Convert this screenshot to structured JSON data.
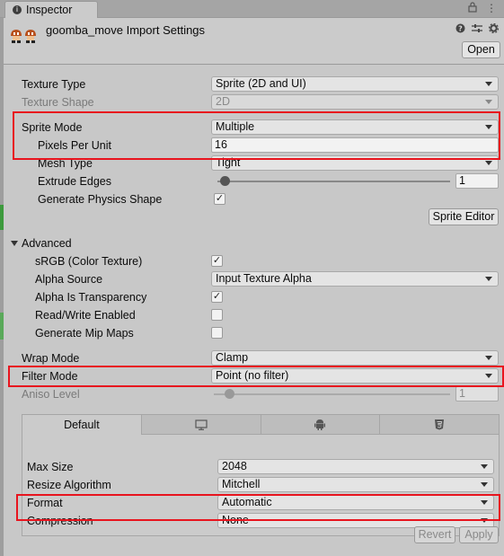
{
  "window": {
    "tab_label": "Inspector"
  },
  "header": {
    "title": "goomba_move Import Settings",
    "open_label": "Open"
  },
  "icons": {
    "info": "info-icon",
    "lock": "lock-icon",
    "more": "more-icon",
    "help": "help-icon",
    "presets": "presets-icon",
    "settings": "gear-icon"
  },
  "texture": {
    "texture_type_label": "Texture Type",
    "texture_type_value": "Sprite (2D and UI)",
    "texture_shape_label": "Texture Shape",
    "texture_shape_value": "2D",
    "sprite_mode_label": "Sprite Mode",
    "sprite_mode_value": "Multiple",
    "ppu_label": "Pixels Per Unit",
    "ppu_value": "16",
    "mesh_type_label": "Mesh Type",
    "mesh_type_value": "Tight",
    "extrude_label": "Extrude Edges",
    "extrude_value": "1",
    "physics_label": "Generate Physics Shape",
    "sprite_editor_label": "Sprite Editor"
  },
  "advanced": {
    "label": "Advanced",
    "srgb_label": "sRGB (Color Texture)",
    "alpha_source_label": "Alpha Source",
    "alpha_source_value": "Input Texture Alpha",
    "alpha_transparency_label": "Alpha Is Transparency",
    "read_write_label": "Read/Write Enabled",
    "mipmaps_label": "Generate Mip Maps"
  },
  "wrap": {
    "wrap_mode_label": "Wrap Mode",
    "wrap_mode_value": "Clamp",
    "filter_mode_label": "Filter Mode",
    "filter_mode_value": "Point (no filter)",
    "aniso_label": "Aniso Level",
    "aniso_value": "1"
  },
  "platform": {
    "tabs": [
      "Default"
    ],
    "max_size_label": "Max Size",
    "max_size_value": "2048",
    "resize_label": "Resize Algorithm",
    "resize_value": "Mitchell",
    "format_label": "Format",
    "format_value": "Automatic",
    "compression_label": "Compression",
    "compression_value": "None"
  },
  "footer": {
    "revert_label": "Revert",
    "apply_label": "Apply"
  },
  "highlight_color": "#e8141e"
}
